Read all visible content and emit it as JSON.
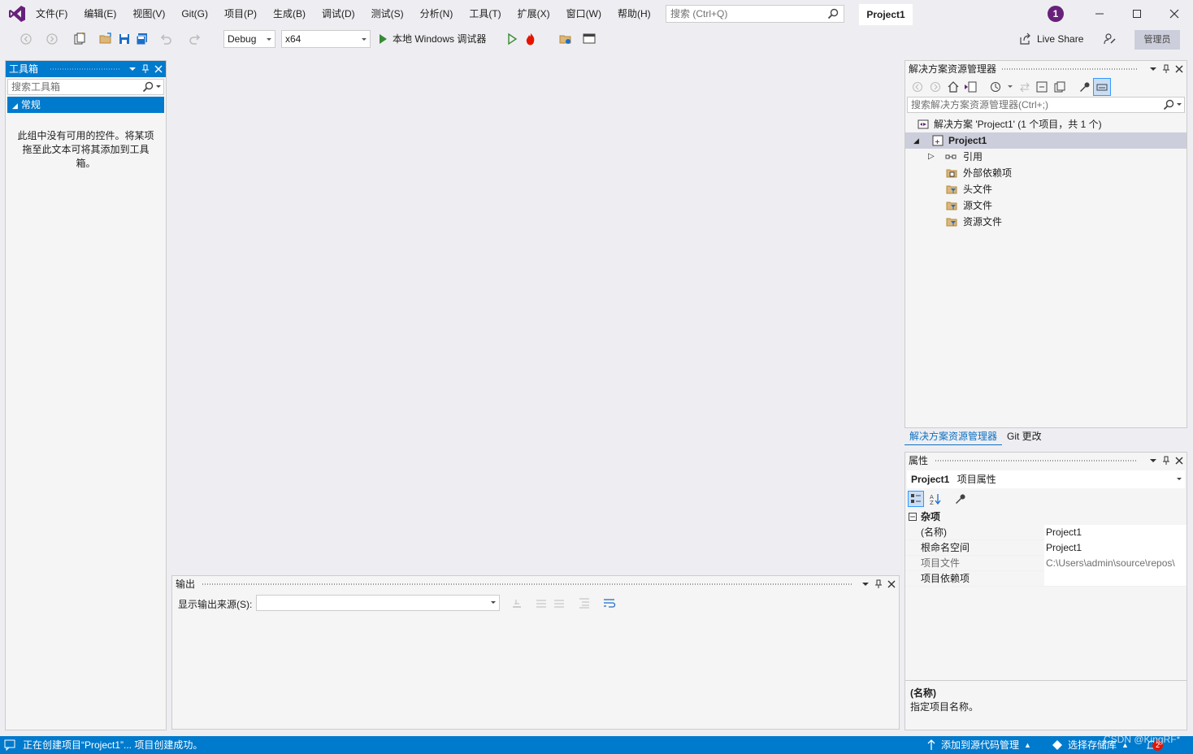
{
  "menu": [
    "文件(F)",
    "编辑(E)",
    "视图(V)",
    "Git(G)",
    "项目(P)",
    "生成(B)",
    "调试(D)",
    "测试(S)",
    "分析(N)",
    "工具(T)",
    "扩展(X)",
    "窗口(W)",
    "帮助(H)"
  ],
  "search": {
    "placeholder": "搜索 (Ctrl+Q)"
  },
  "project_title": "Project1",
  "notifications": "1",
  "toolbar": {
    "config": "Debug",
    "platform": "x64",
    "run_label": "本地 Windows 调试器",
    "live_share": "Live Share",
    "admin": "管理员"
  },
  "toolbox": {
    "title": "工具箱",
    "search_placeholder": "搜索工具箱",
    "group": "常规",
    "empty_text": "此组中没有可用的控件。将某项拖至此文本可将其添加到工具箱。"
  },
  "output": {
    "title": "输出",
    "source_label": "显示输出来源(S):"
  },
  "solution_explorer": {
    "title": "解决方案资源管理器",
    "search_placeholder": "搜索解决方案资源管理器(Ctrl+;)",
    "solution_label": "解决方案 'Project1' (1 个项目，共 1 个)",
    "project": "Project1",
    "items": [
      "引用",
      "外部依赖项",
      "头文件",
      "源文件",
      "资源文件"
    ],
    "tabs": [
      "解决方案资源管理器",
      "Git 更改"
    ]
  },
  "properties": {
    "title": "属性",
    "object_name": "Project1",
    "object_type": "项目属性",
    "category": "杂项",
    "rows": [
      {
        "key": "(名称)",
        "value": "Project1"
      },
      {
        "key": "根命名空间",
        "value": "Project1"
      },
      {
        "key": "项目文件",
        "value": "C:\\Users\\admin\\source\\repos\\"
      },
      {
        "key": "项目依赖项",
        "value": ""
      }
    ],
    "desc_title": "(名称)",
    "desc_text": "指定项目名称。"
  },
  "status": {
    "message": "正在创建项目“Project1”... 项目创建成功。",
    "source_control": "添加到源代码管理",
    "repo": "选择存储库",
    "bell_count": "2"
  },
  "watermark": "CSDN @KingRF*",
  "colors": {
    "accent": "#007acc",
    "vs_purple": "#68217a",
    "selection": "#cccedb"
  }
}
